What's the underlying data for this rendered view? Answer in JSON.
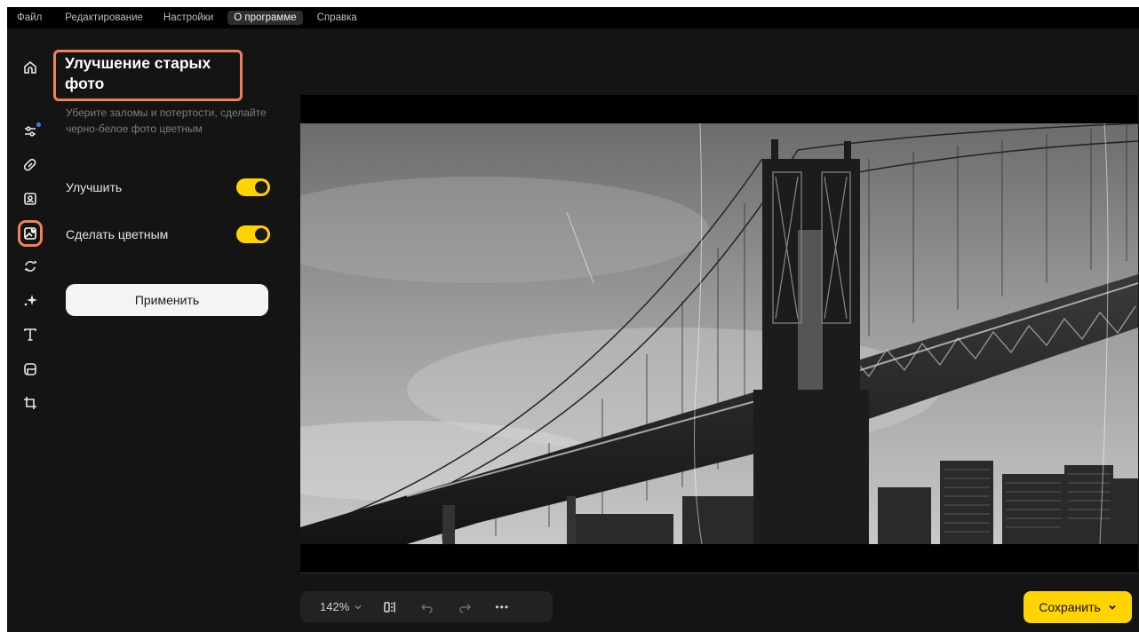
{
  "menu": [
    "Файл",
    "Редактирование",
    "Настройки",
    "О программе",
    "Справка"
  ],
  "menu_active_index": 3,
  "rail": {
    "icons": [
      "home-icon",
      "adjustments-icon",
      "eraser-icon",
      "portrait-icon",
      "photo-restore-icon",
      "replace-icon",
      "sparkle-icon",
      "text-icon",
      "frame-icon",
      "crop-icon"
    ],
    "active": "photo-restore-icon"
  },
  "panel": {
    "title": "Улучшение старых фото",
    "subtitle": "Уберите заломы и потертости, сделайте черно-белое фото цветным",
    "toggles": [
      {
        "label": "Улучшить",
        "on": true
      },
      {
        "label": "Сделать цветным",
        "on": true
      }
    ],
    "apply_label": "Применить"
  },
  "bottombar": {
    "zoom": "142%",
    "more": "•••"
  },
  "save_label": "Сохранить",
  "colors": {
    "accent": "#ffd400",
    "highlight": "#f07f5a",
    "background": "#141414"
  }
}
